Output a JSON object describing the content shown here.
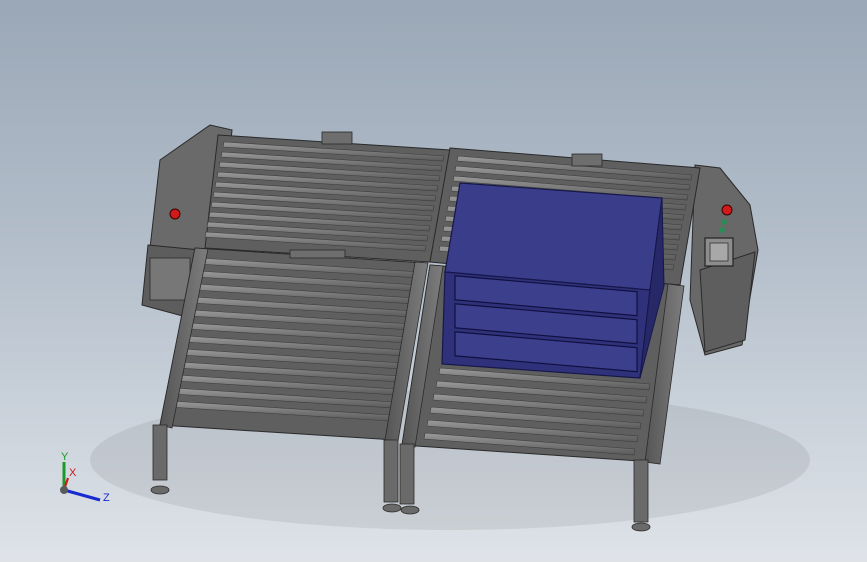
{
  "viewport": {
    "background_top": "#9aa7b6",
    "background_bottom": "#dfe3e8"
  },
  "model": {
    "frame_color": "#6b6b6b",
    "roller_color": "#7a7a7a",
    "box_color": "#3c3f8c",
    "indicator_red": "#d11a1a",
    "indicator_green": "#2e8b57"
  },
  "triad": {
    "x_label": "X",
    "y_label": "Y",
    "z_label": "Z",
    "x_color": "#d11a1a",
    "y_color": "#1a9a2a",
    "z_color": "#1a2ad1"
  },
  "icons": {
    "triad": "axis-triad-icon",
    "box": "storage-box-icon",
    "panel": "control-panel-icon"
  }
}
